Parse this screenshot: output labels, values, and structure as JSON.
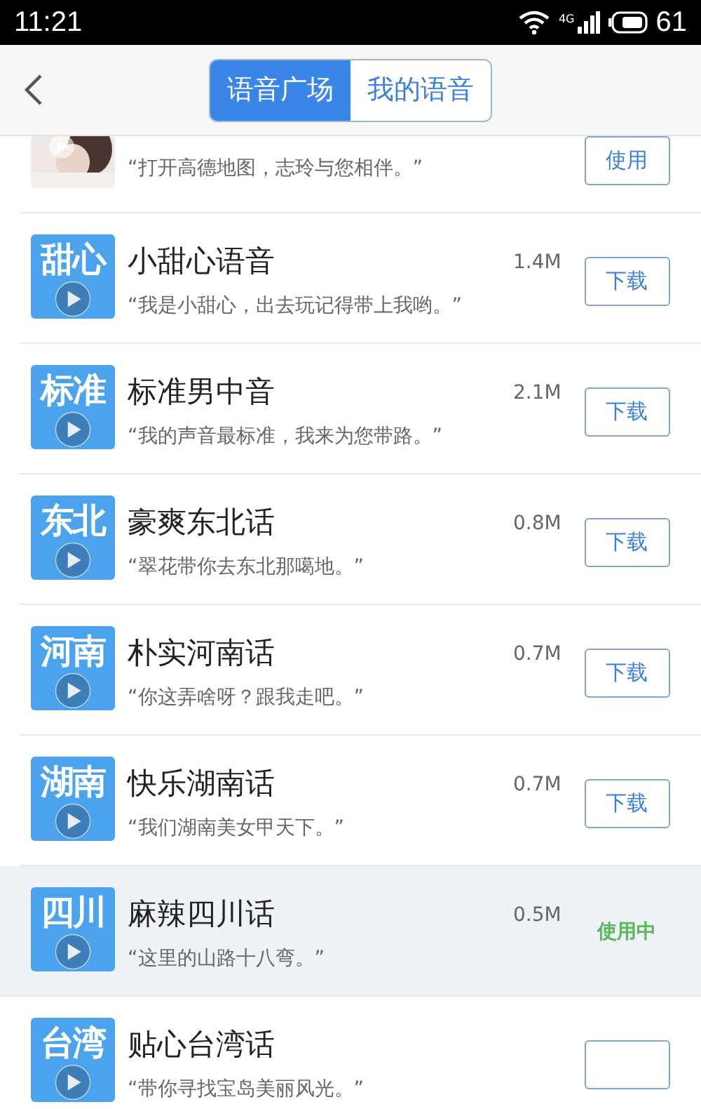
{
  "status_bar": {
    "time": "11:21",
    "network": "4G",
    "battery": "61"
  },
  "header": {
    "tabs": [
      {
        "label": "语音广场",
        "selected": true
      },
      {
        "label": "我的语音",
        "selected": false
      }
    ]
  },
  "voices": [
    {
      "kind": "partial",
      "subtitle": "“打开高德地图，志玲与您相伴。”",
      "selected": false,
      "action": {
        "kind": "button",
        "label": "使用"
      }
    },
    {
      "kind": "full",
      "thumbnail": {
        "kind": "text",
        "text": "甜心"
      },
      "title": "小甜心语音",
      "size": "1.4M",
      "subtitle": "“我是小甜心，出去玩记得带上我哟。”",
      "selected": false,
      "action": {
        "kind": "button",
        "label": "下载"
      }
    },
    {
      "kind": "full",
      "thumbnail": {
        "kind": "text",
        "text": "标准"
      },
      "title": "标准男中音",
      "size": "2.1M",
      "subtitle": "“我的声音最标准，我来为您带路。”",
      "selected": false,
      "action": {
        "kind": "button",
        "label": "下载"
      }
    },
    {
      "kind": "full",
      "thumbnail": {
        "kind": "text",
        "text": "东北"
      },
      "title": "豪爽东北话",
      "size": "0.8M",
      "subtitle": "“翠花带你去东北那噶地。”",
      "selected": false,
      "action": {
        "kind": "button",
        "label": "下载"
      }
    },
    {
      "kind": "full",
      "thumbnail": {
        "kind": "text",
        "text": "河南"
      },
      "title": "朴实河南话",
      "size": "0.7M",
      "subtitle": "“你这弄啥呀？跟我走吧。”",
      "selected": false,
      "action": {
        "kind": "button",
        "label": "下载"
      }
    },
    {
      "kind": "full",
      "thumbnail": {
        "kind": "text",
        "text": "湖南"
      },
      "title": "快乐湖南话",
      "size": "0.7M",
      "subtitle": "“我们湖南美女甲天下。”",
      "selected": false,
      "action": {
        "kind": "button",
        "label": "下载"
      }
    },
    {
      "kind": "full",
      "thumbnail": {
        "kind": "text",
        "text": "四川"
      },
      "title": "麻辣四川话",
      "size": "0.5M",
      "subtitle": "“这里的山路十八弯。”",
      "selected": true,
      "action": {
        "kind": "status",
        "label": "使用中"
      }
    },
    {
      "kind": "full",
      "thumbnail": {
        "kind": "text",
        "text": "台湾"
      },
      "title": "贴心台湾话",
      "subtitle": "“带你寻找宝岛美丽风光。”",
      "selected": false,
      "action": {
        "kind": "button"
      }
    }
  ]
}
